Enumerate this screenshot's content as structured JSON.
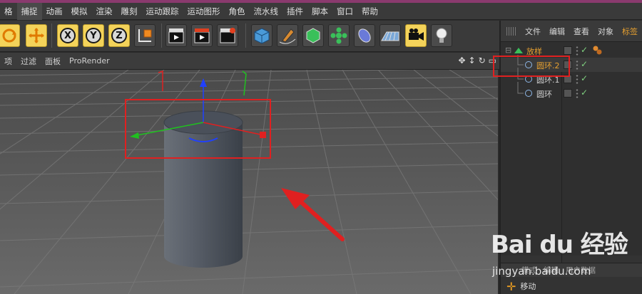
{
  "menubar": {
    "items": [
      "格",
      "捕捉",
      "动画",
      "模拟",
      "渲染",
      "雕刻",
      "运动跟踪",
      "运动图形",
      "角色",
      "流水线",
      "插件",
      "脚本",
      "窗口",
      "帮助"
    ],
    "active_index": 1
  },
  "toolbar": {
    "axis_x": "X",
    "axis_y": "Y",
    "axis_z": "Z"
  },
  "viewbar": {
    "items": [
      "项",
      "过滤",
      "面板",
      "ProRender"
    ]
  },
  "object_panel": {
    "menu": [
      "文件",
      "编辑",
      "查看",
      "对象",
      "标签"
    ],
    "objects": [
      {
        "name": "放样",
        "color": "#e6a030"
      },
      {
        "name": "圆环.2",
        "color": "#e6a030"
      },
      {
        "name": "圆环.1",
        "color": "#d0d0d0"
      },
      {
        "name": "圆环",
        "color": "#d0d0d0"
      }
    ]
  },
  "attributes": {
    "tabs": [
      "模式",
      "编辑",
      "用户数据"
    ],
    "tool_name": "移动"
  },
  "watermark": {
    "logo": "Bai du 经验",
    "url": "jingyan.baidu.com"
  },
  "colors": {
    "highlight_box": "#e02020",
    "arrow": "#e02020",
    "axis_x": "#e02020",
    "axis_y": "#20c020",
    "axis_z": "#2040ff"
  }
}
